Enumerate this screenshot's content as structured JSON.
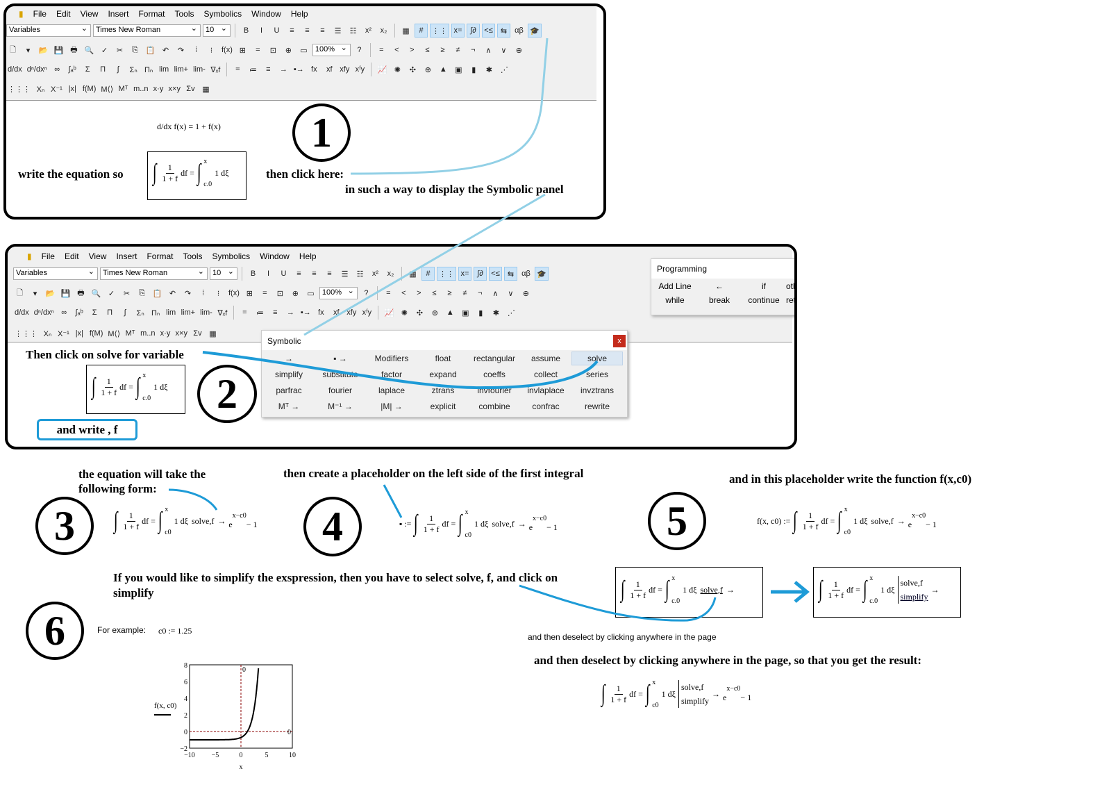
{
  "menu": [
    "File",
    "Edit",
    "View",
    "Insert",
    "Format",
    "Tools",
    "Symbolics",
    "Window",
    "Help"
  ],
  "toolbar": {
    "style_select": "Variables",
    "font_select": "Times New Roman",
    "size_select": "10",
    "zoom_select": "100%",
    "format_buttons": [
      "B",
      "I",
      "U",
      "≡",
      "≡",
      "≡",
      "☰",
      "☷",
      "x²",
      "x₂"
    ],
    "palette_buttons": [
      "▦",
      "#",
      "⋮⋮",
      "x=",
      "∫∂",
      "<≤",
      "⇆",
      "αβ",
      "🎓"
    ],
    "standard_buttons": [
      "🗋",
      "▾",
      "📂",
      "💾",
      "🖶",
      "🔍",
      "✓",
      "✂",
      "⎘",
      "📋",
      "↶",
      "↷",
      "⁞",
      "⁝",
      "f(x)",
      "⊞",
      "=",
      "⊡",
      "⊕",
      "▭"
    ],
    "help_button": "?",
    "boolean_buttons": [
      "=",
      "<",
      ">",
      "≤",
      "≥",
      "≠",
      "¬",
      "∧",
      "∨",
      "⊕"
    ],
    "calculus_buttons": [
      "d/dx",
      "dⁿ/dxⁿ",
      "∞",
      "∫ₐᵇ",
      "Σ",
      "Π",
      "∫",
      "Σₙ",
      "Πₙ",
      "lim",
      "lim+",
      "lim-",
      "∇ₓf"
    ],
    "eval_buttons": [
      "=",
      "≔",
      "≡",
      "→",
      "▪→",
      "fx",
      "xf",
      "xfy",
      "xᶠy"
    ],
    "graph_buttons": [
      "📈",
      "✺",
      "✣",
      "⊕",
      "▲",
      "▣",
      "▮",
      "✱",
      "⋰"
    ],
    "matrix_buttons": [
      "⋮⋮⋮",
      "Xₙ",
      "X⁻¹",
      "|x|",
      "f(M)",
      "M⟨⟩",
      "Mᵀ",
      "m..n",
      "x·y",
      "x×y",
      "Σv",
      "▦"
    ]
  },
  "step1": {
    "number": "1",
    "derivative": "d/dx f(x) = 1 + f(x)",
    "write_label": "write the equation so",
    "click_label": "then click here:",
    "panel_label": "in such a way to display the Symbolic panel"
  },
  "step2": {
    "number": "2",
    "instruction": "Then click on solve for variable",
    "write_f": "and write , f",
    "symbolic_panel": {
      "title": "Symbolic",
      "close": "x",
      "items": [
        "→",
        "▪ →",
        "Modifiers",
        "float",
        "rectangular",
        "assume",
        "solve",
        "simplify",
        "substitute",
        "factor",
        "expand",
        "coeffs",
        "collect",
        "series",
        "parfrac",
        "fourier",
        "laplace",
        "ztrans",
        "invfourier",
        "invlaplace",
        "invztrans",
        "Mᵀ →",
        "M⁻¹ →",
        "|M| →",
        "explicit",
        "combine",
        "confrac",
        "rewrite"
      ],
      "highlighted": "solve"
    },
    "programming_panel": {
      "title": "Programming",
      "items": [
        "Add Line",
        "←",
        "if",
        "otherwise",
        "while",
        "break",
        "continue",
        "return"
      ]
    }
  },
  "step3": {
    "number": "3",
    "text": "the equation will take the following form:"
  },
  "step4": {
    "number": "4",
    "text": "then create a placeholder on the left side of the first integral"
  },
  "step5": {
    "number": "5",
    "text": "and in this placeholder write the function f(x,c0)"
  },
  "step6": {
    "number": "6",
    "text": "If you would like to simplify the exspression, then you have to select solve, f, and click on  simplify",
    "example_label": "For example:",
    "example_value": "c0 := 1.25",
    "deselect_small": "and then deselect by clicking anywhere in the page",
    "deselect_bold": "and then deselect by clicking anywhere in the page,  so that you get the result:"
  },
  "math": {
    "one": "1",
    "den": "1 + f",
    "df": "df =",
    "upper": "x",
    "lower_c0": "c.0",
    "lower_c_0": "c0",
    "dxi": "1 dξ",
    "solve": "solve,f",
    "simplify": "simplify",
    "arrow": "→",
    "result_base": "e",
    "result_exp": "x−c0",
    "result_tail": "− 1",
    "lhs_placeholder": "▪ :=",
    "lhs_func": "f(x, c0) :="
  },
  "chart_data": {
    "type": "line",
    "ylabel": "f(x, c0)",
    "xlabel": "x",
    "xlim": [
      -10,
      10
    ],
    "ylim": [
      -2,
      8
    ],
    "xticks": [
      "−10",
      "−5",
      "0",
      "5",
      "10"
    ],
    "yticks": [
      "8",
      "6",
      "4",
      "2",
      "0",
      "−2"
    ],
    "series": [
      {
        "function": "exp(x − 1.25) − 1",
        "color": "#000000"
      }
    ],
    "markers": {
      "x_zero_label": "0",
      "y_zero_label": "0",
      "marker_color": "#8b0000"
    }
  },
  "colors": {
    "annotation_blue": "#1e9bd7",
    "light_blue": "#92d0e6",
    "highlight": "#dbe7f3",
    "close_red": "#c42b1c"
  }
}
